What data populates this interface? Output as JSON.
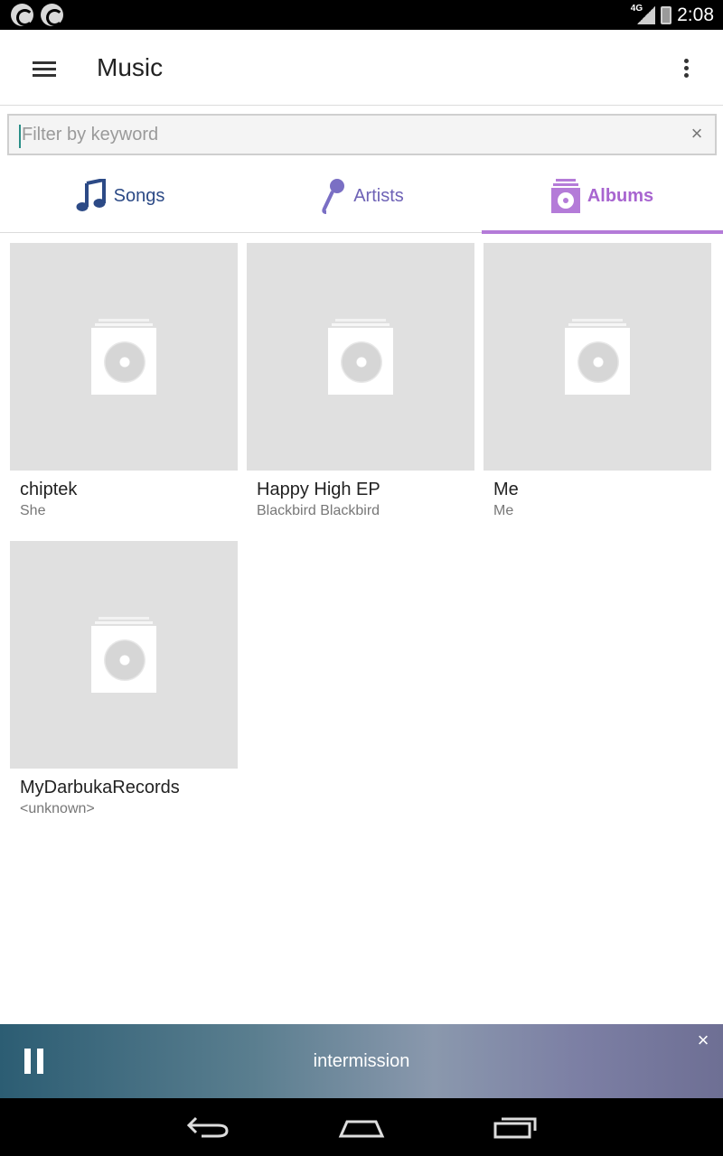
{
  "status_bar": {
    "network": "4G",
    "time": "2:08"
  },
  "app_bar": {
    "title": "Music"
  },
  "filter": {
    "placeholder": "Filter by keyword",
    "value": ""
  },
  "tabs": [
    {
      "label": "Songs",
      "icon": "music-note-icon",
      "selected": false
    },
    {
      "label": "Artists",
      "icon": "microphone-icon",
      "selected": false
    },
    {
      "label": "Albums",
      "icon": "album-icon",
      "selected": true
    }
  ],
  "albums": [
    {
      "title": "chiptek",
      "artist": "She"
    },
    {
      "title": "Happy High EP",
      "artist": "Blackbird Blackbird"
    },
    {
      "title": "Me",
      "artist": "Me"
    },
    {
      "title": "MyDarbukaRecords",
      "artist": "<unknown>"
    }
  ],
  "now_playing": {
    "title": "intermission",
    "state": "playing"
  },
  "colors": {
    "accent": "#b47bd8",
    "songs_tab": "#2c4a86",
    "artists_tab": "#6e62b6",
    "cursor": "#2a8f88"
  }
}
